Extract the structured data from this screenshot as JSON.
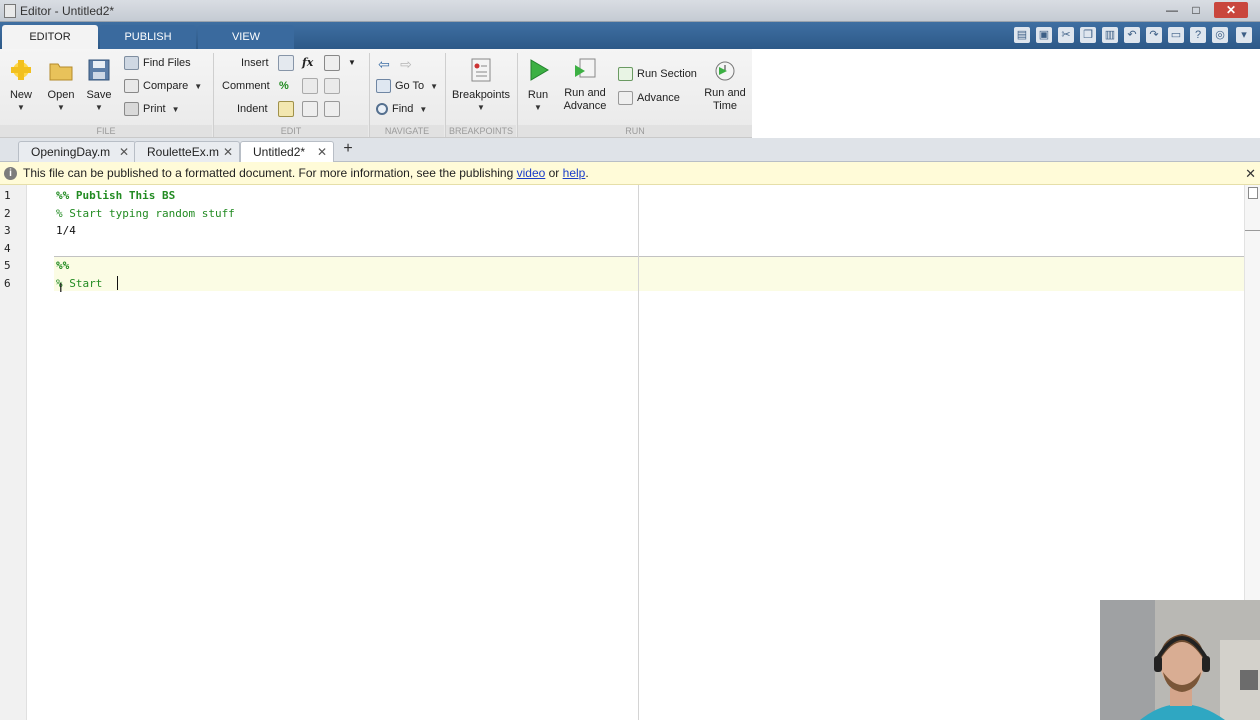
{
  "window": {
    "title": "Editor - Untitled2*",
    "minimize": "—",
    "maximize": "□",
    "close": "✕"
  },
  "ribbon_tabs": [
    "EDITOR",
    "PUBLISH",
    "VIEW"
  ],
  "quick_access": {
    "icons": [
      "layout-icon",
      "save-icon",
      "cut-icon",
      "copy-icon",
      "paste-icon",
      "undo-icon",
      "redo-icon",
      "switch-windows-icon",
      "help-icon",
      "search-docs-icon",
      "minimize-toolstrip-icon"
    ],
    "help_glyph": "?",
    "expand_glyph": "▾"
  },
  "toolstrip": {
    "file": {
      "label": "FILE",
      "new": "New",
      "open": "Open",
      "save": "Save",
      "find_files": "Find Files",
      "compare": "Compare",
      "print": "Print"
    },
    "edit": {
      "label": "EDIT",
      "insert": "Insert",
      "fx": "fx",
      "comment": "Comment",
      "percent": "%",
      "indent": "Indent"
    },
    "navigate": {
      "label": "NAVIGATE",
      "go_to": "Go To",
      "find": "Find"
    },
    "breakpoints": {
      "label": "BREAKPOINTS",
      "button": "Breakpoints"
    },
    "run": {
      "label": "RUN",
      "run": "Run",
      "run_and_advance_1": "Run and",
      "run_and_advance_2": "Advance",
      "run_section": "Run Section",
      "advance": "Advance",
      "run_and_time_1": "Run and",
      "run_and_time_2": "Time"
    },
    "dropdown_glyph": "▼"
  },
  "document_tabs": [
    {
      "label": "OpeningDay.m",
      "close": "✕"
    },
    {
      "label": "RouletteEx.m",
      "close": "✕"
    },
    {
      "label": "Untitled2*",
      "close": "✕"
    }
  ],
  "add_tab": "+",
  "infobar": {
    "icon": "i",
    "message": "This file can be published to a formatted document. For more information, see the publishing ",
    "link_video": "video",
    "or": " or ",
    "link_help": "help",
    "period": ".",
    "close": "✕"
  },
  "editor": {
    "line_numbers": [
      "1",
      "2",
      "3",
      "4",
      "5",
      "6"
    ],
    "lines": [
      {
        "text": "%% Publish This BS",
        "kind": "cellcomment"
      },
      {
        "text": "% Start typing random stuff",
        "kind": "comment"
      },
      {
        "text": "1/4",
        "kind": "plain"
      },
      {
        "text": "",
        "kind": "plain"
      },
      {
        "text": "%%",
        "kind": "cellcomment"
      },
      {
        "text": "% Start ",
        "kind": "comment"
      }
    ]
  },
  "colors": {
    "ribbon_blue": "#2d5988",
    "comment_green": "#228b22",
    "info_yellow": "#fffbd8",
    "cell_highlight": "#fbfce4",
    "run_green": "#3cb043"
  }
}
